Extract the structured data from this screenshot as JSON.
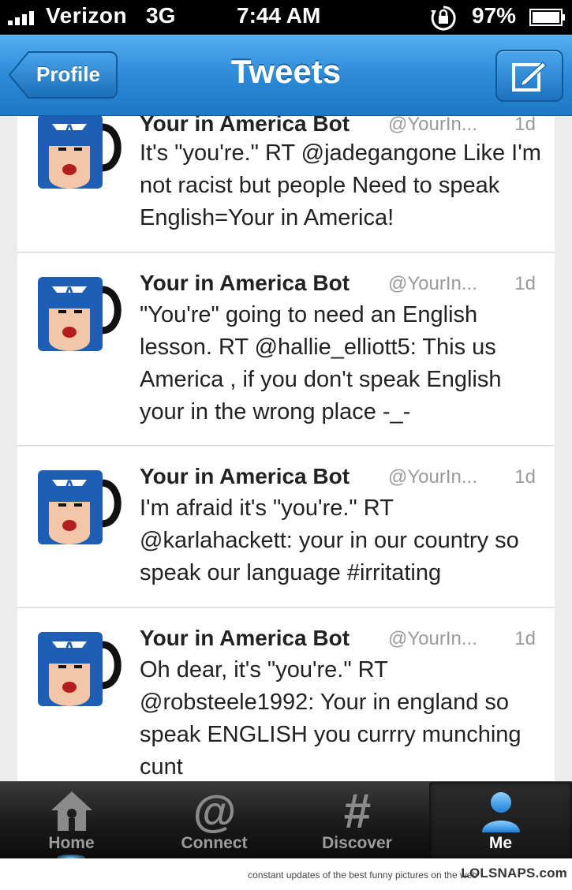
{
  "status_bar": {
    "carrier": "Verizon",
    "network": "3G",
    "time": "7:44 AM",
    "battery_percent": "97%",
    "icons": [
      "signal-icon",
      "rotation-lock-icon",
      "battery-icon"
    ]
  },
  "nav": {
    "back_label": "Profile",
    "title": "Tweets",
    "compose_icon": "compose-icon"
  },
  "tweets": [
    {
      "name": "Your in America Bot",
      "handle": "@YourIn...",
      "time": "1d",
      "text": "It's \"you're.\" RT @jadegangone Like I'm not racist but people Need to speak English=Your in America!"
    },
    {
      "name": "Your in America Bot",
      "handle": "@YourIn...",
      "time": "1d",
      "text": "\"You're\" going to need an English lesson. RT @hallie_elliott5: This us America , if you don't speak English your in the wrong place -_-"
    },
    {
      "name": "Your in America Bot",
      "handle": "@YourIn...",
      "time": "1d",
      "text": "I'm afraid it's \"you're.\" RT @karlahackett: your in our country so speak our language #irritating"
    },
    {
      "name": "Your in America Bot",
      "handle": "@YourIn...",
      "time": "1d",
      "text": "Oh dear, it's \"you're.\" RT @robsteele1992: Your in england so speak ENGLISH you currry munching cunt"
    }
  ],
  "tabs": [
    {
      "label": "Home",
      "icon": "home-icon"
    },
    {
      "label": "Connect",
      "icon": "at-sign-icon"
    },
    {
      "label": "Discover",
      "icon": "hashtag-icon"
    },
    {
      "label": "Me",
      "icon": "person-icon",
      "active": true
    }
  ],
  "footer": {
    "text": "constant updates of the best funny pictures on the web",
    "brand": "LOLSNAPS.com"
  },
  "colors": {
    "nav_blue": "#2c8ad8",
    "tab_bar": "#1c1c1c",
    "timeline_bg": "#ececec"
  }
}
